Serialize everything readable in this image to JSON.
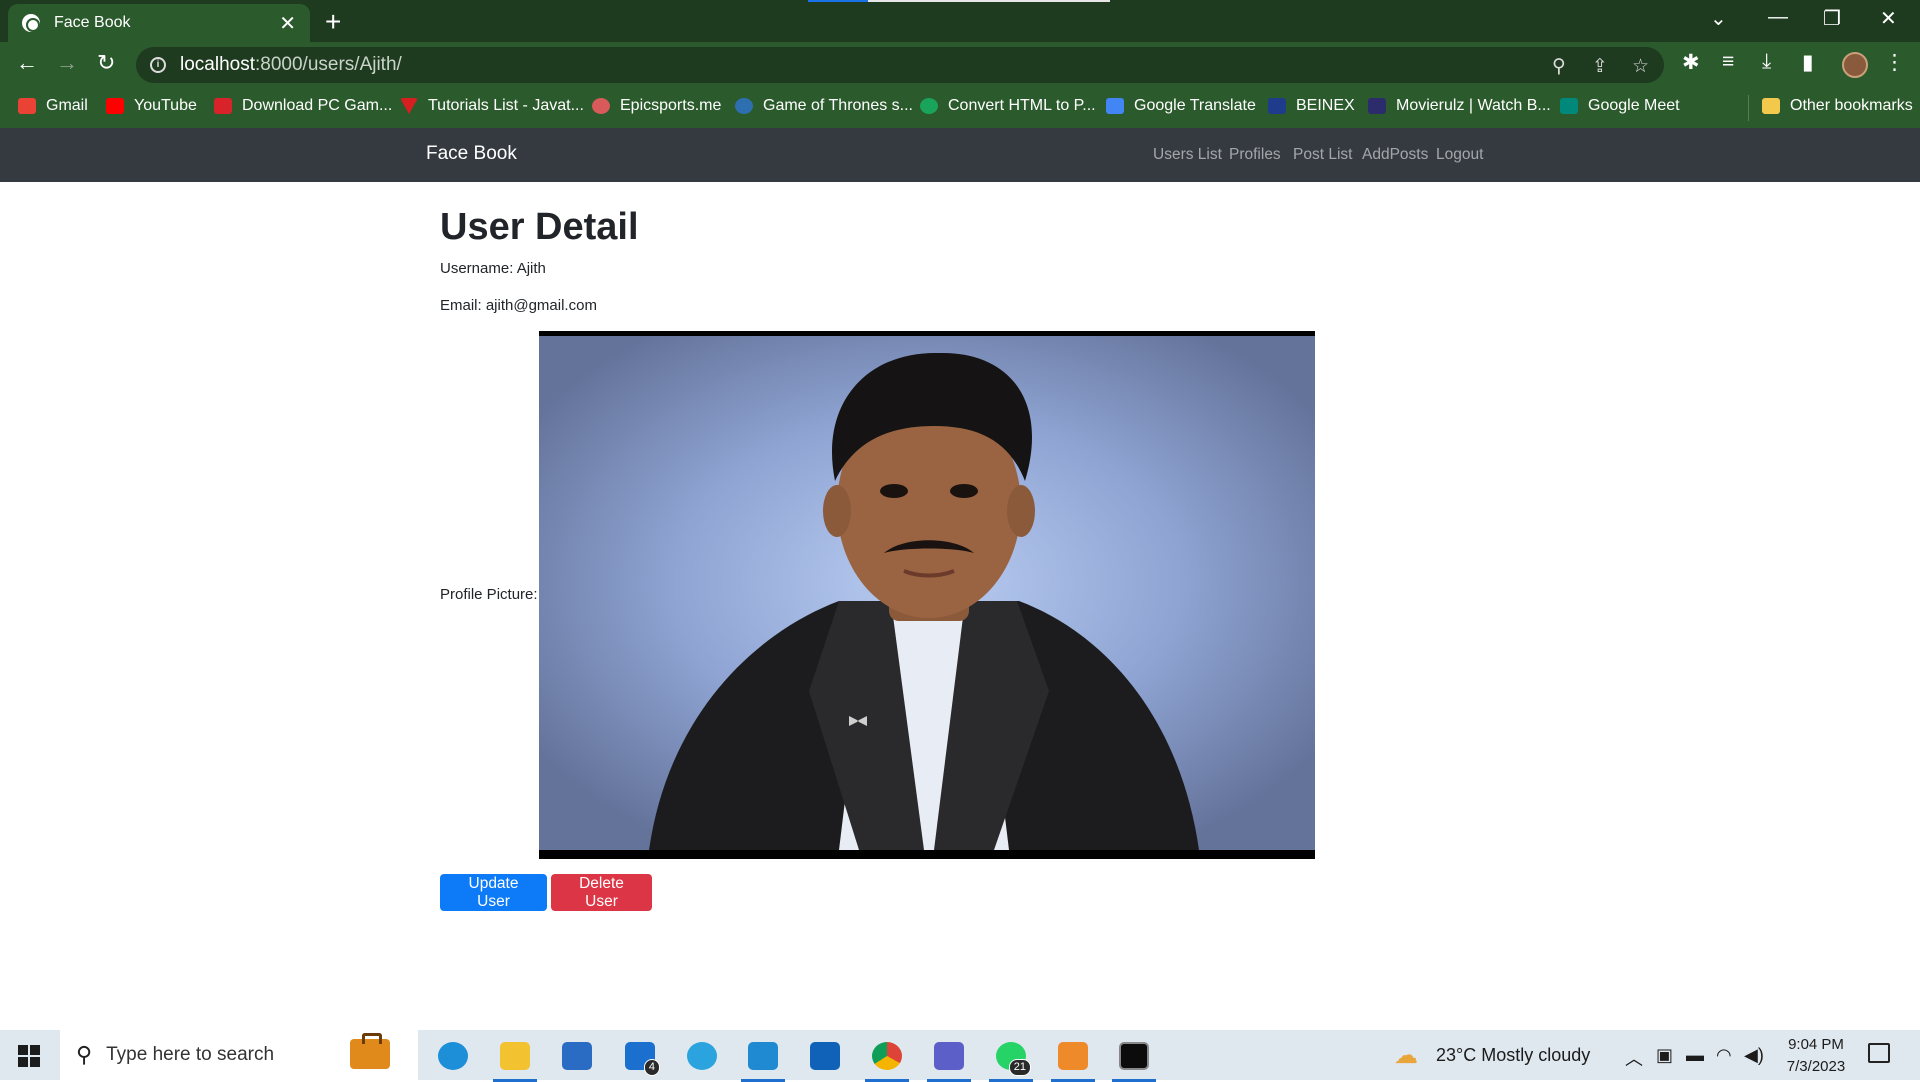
{
  "browser": {
    "tab_title": "Face Book",
    "tab_close": "✕",
    "new_tab": "+",
    "url_host": "localhost",
    "url_path": ":8000/users/Ajith/",
    "bookmarks": [
      {
        "label": "Gmail",
        "icon": "gmail-icon",
        "color": "#ea4335"
      },
      {
        "label": "YouTube",
        "icon": "youtube-icon",
        "color": "#ff0000"
      },
      {
        "label": "Download PC Gam...",
        "icon": "game-icon",
        "color": "#d8232a"
      },
      {
        "label": "Tutorials List - Javat...",
        "icon": "javatpoint-icon",
        "color": "#d62020"
      },
      {
        "label": "Epicsports.me",
        "icon": "epicsports-icon",
        "color": "#d85a5a"
      },
      {
        "label": "Game of Thrones s...",
        "icon": "globe-icon",
        "color": "#2e6fb0"
      },
      {
        "label": "Convert HTML to P...",
        "icon": "convert-icon",
        "color": "#19a35b"
      },
      {
        "label": "Google Translate",
        "icon": "translate-icon",
        "color": "#4285f4"
      },
      {
        "label": "BEINEX",
        "icon": "beinex-icon",
        "color": "#1f3b8c"
      },
      {
        "label": "Movierulz | Watch B...",
        "icon": "movierulz-icon",
        "color": "#2c2c6c"
      },
      {
        "label": "Google Meet",
        "icon": "meet-icon",
        "color": "#00897b"
      }
    ],
    "other_bookmarks": "Other bookmarks"
  },
  "navbar": {
    "brand": "Face Book",
    "links": [
      "Users List",
      "Profiles",
      "Post List",
      "AddPosts",
      "Logout"
    ]
  },
  "user_detail": {
    "title": "User Detail",
    "username": "Username: Ajith",
    "email": "Email: ajith@gmail.com",
    "profile_picture_label": "Profile Picture:",
    "update_button": "Update User",
    "delete_button": "Delete User"
  },
  "taskbar": {
    "search_placeholder": "Type here to search",
    "mail_badge": "4",
    "whatsapp_badge": "21",
    "weather": "23°C  Mostly cloudy",
    "time": "9:04 PM",
    "date": "7/3/2023"
  },
  "colors": {
    "chrome_dark": "#1e3a1f",
    "chrome_toolbar": "#2b5a2c",
    "navbar": "#343a40",
    "primary": "#0d7bf7",
    "danger": "#dc3545"
  }
}
